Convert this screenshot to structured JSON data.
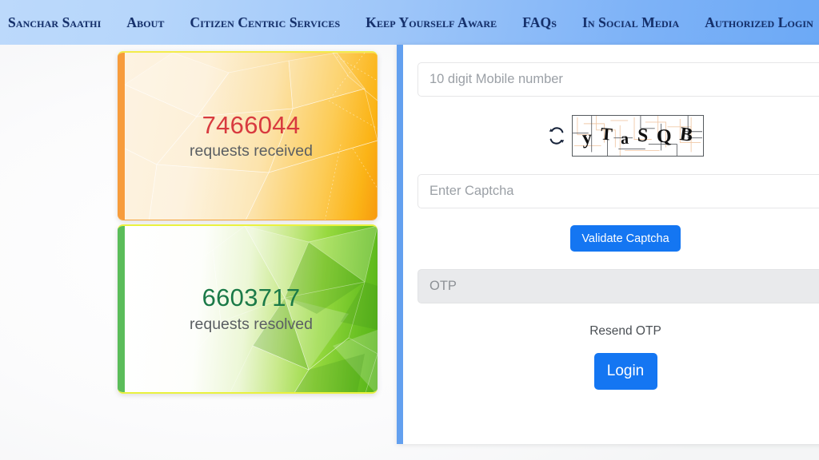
{
  "navbar": {
    "brand": "Sanchar Saathi",
    "items": [
      {
        "label": "About"
      },
      {
        "label": "Citizen Centric Services"
      },
      {
        "label": "Keep Yourself Aware"
      },
      {
        "label": "FAQs"
      },
      {
        "label": "In Social Media"
      },
      {
        "label": "Authorized Login"
      }
    ],
    "bg_left": "#bcd9fb",
    "bg_right": "#6ca9f6",
    "text_color": "#15306b"
  },
  "stats": [
    {
      "number": "7466044",
      "label": "requests received",
      "number_color": "#d83a3f",
      "accent_color": "#f79c3c"
    },
    {
      "number": "6603717",
      "label": "requests resolved",
      "number_color": "#1b7a48",
      "accent_color": "#5bbd5a"
    }
  ],
  "login": {
    "accent_color": "#63a0ef",
    "mobile_input": {
      "placeholder": "10 digit Mobile number",
      "value": ""
    },
    "captcha": {
      "refresh_icon": "refresh-icon",
      "characters": [
        "y",
        "T",
        "a",
        "S",
        "Q",
        "B"
      ],
      "text": "yTaSQB"
    },
    "captcha_input": {
      "placeholder": "Enter Captcha",
      "value": ""
    },
    "validate_button": {
      "label": "Validate Captcha",
      "color": "#1476f2"
    },
    "otp_input": {
      "placeholder": "OTP",
      "value": "",
      "disabled": true
    },
    "resend_otp": {
      "label": "Resend OTP"
    },
    "login_button": {
      "label": "Login",
      "color": "#1476f2"
    }
  }
}
